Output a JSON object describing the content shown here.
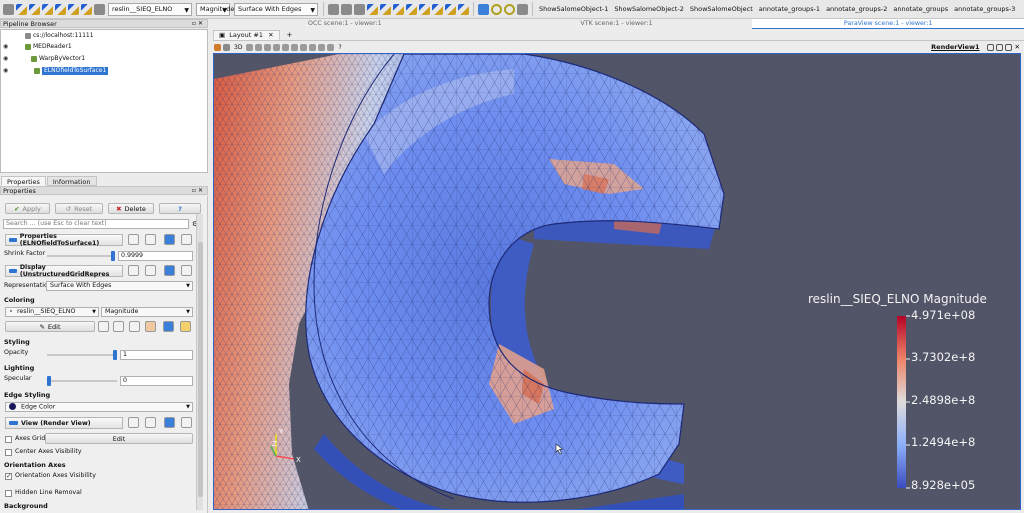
{
  "toolbar": {
    "array_select": "reslin__SIEQ_ELNO",
    "component_select": "Magnitude",
    "representation_select": "Surface With Edges",
    "custom_buttons": [
      "ShowSalomeObject-1",
      "ShowSalomeObject-2",
      "ShowSalomeObject",
      "annotate_groups-1",
      "annotate_groups-2",
      "annotate_groups",
      "annotate_groups-3"
    ]
  },
  "pipeline_browser": {
    "title": "Pipeline Browser",
    "items": [
      "cs://localhost:11111",
      "MEDReader1",
      "WarpByVector1",
      "ELNOfieldToSurface1"
    ]
  },
  "properties_tabs": [
    "Properties",
    "Information"
  ],
  "properties": {
    "title": "Properties",
    "apply": "Apply",
    "reset": "Reset",
    "delete": "Delete",
    "help": "?",
    "search_placeholder": "Search ... (use Esc to clear text)",
    "section_properties": "Properties (ELNOfieldToSurface1)",
    "shrink_factor_label": "Shrink Factor",
    "shrink_factor_value": "0.9999",
    "section_display": "Display (UnstructuredGridRepres",
    "representation_label": "Representation",
    "representation_value": "Surface With Edges",
    "coloring_label": "Coloring",
    "coloring_array": "reslin__SIEQ_ELNO",
    "coloring_component": "Magnitude",
    "edit": "Edit",
    "styling_label": "Styling",
    "opacity_label": "Opacity",
    "opacity_value": "1",
    "opacity_level": 1.0,
    "lighting_label": "Lighting",
    "specular_label": "Specular",
    "specular_value": "0",
    "edge_styling_label": "Edge Styling",
    "edge_color": "Edge Color",
    "section_view": "View (Render View)",
    "axes_grid": "Axes Grid",
    "axes_grid_edit": "Edit",
    "center_axes": "Center Axes Visibility",
    "orientation_axes_label": "Orientation Axes",
    "orientation_axes_visibility": "Orientation Axes Visibility",
    "hidden_line_removal": "Hidden Line Removal",
    "background_label": "Background"
  },
  "view_tabs": [
    "OCC scene:1 - viewer:1",
    "VTK scene:1 - viewer:1",
    "ParaView scene:1 - viewer:1"
  ],
  "layout_tab": "Layout #1",
  "layout_add": "+",
  "render_view_label": "RenderView1",
  "view_3d": "3D",
  "colorbar": {
    "title": "reslin__SIEQ_ELNO Magnitude",
    "ticks": [
      "4.971e+08",
      "3.7302e+8",
      "2.4898e+8",
      "1.2494e+8",
      "8.928e+05"
    ],
    "colors": [
      "#b40426",
      "#ee8468",
      "#dddcdc",
      "#8caff9",
      "#3b4cc0"
    ]
  },
  "axes_triad": {
    "y": "Y",
    "z": "Z",
    "x": "X"
  }
}
